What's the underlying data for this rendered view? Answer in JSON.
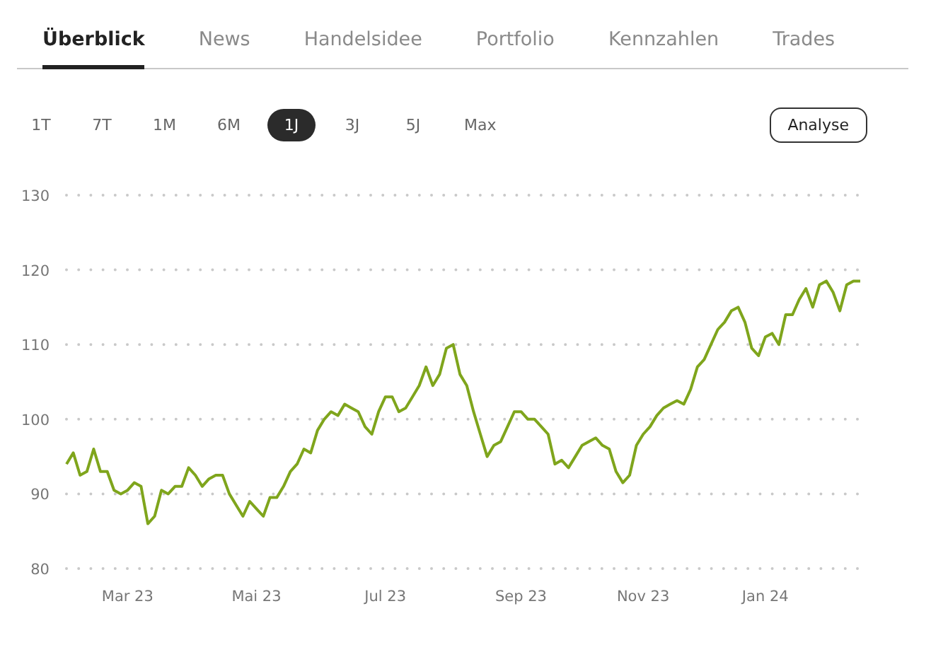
{
  "tabs": [
    {
      "label": "Überblick",
      "selected": true
    },
    {
      "label": "News",
      "selected": false
    },
    {
      "label": "Handelsidee",
      "selected": false
    },
    {
      "label": "Portfolio",
      "selected": false
    },
    {
      "label": "Kennzahlen",
      "selected": false
    },
    {
      "label": "Trades",
      "selected": false
    }
  ],
  "ranges": [
    {
      "label": "1T",
      "selected": false
    },
    {
      "label": "7T",
      "selected": false
    },
    {
      "label": "1M",
      "selected": false
    },
    {
      "label": "6M",
      "selected": false
    },
    {
      "label": "1J",
      "selected": true
    },
    {
      "label": "3J",
      "selected": false
    },
    {
      "label": "5J",
      "selected": false
    },
    {
      "label": "Max",
      "selected": false
    }
  ],
  "analyse_button": "Analyse",
  "chart": {
    "chart_data": {
      "type": "line",
      "grid": true,
      "ylim": [
        80,
        130
      ],
      "yticks": [
        80,
        90,
        100,
        110,
        120,
        130
      ],
      "categories": [
        null,
        null,
        null,
        null,
        null,
        null,
        null,
        null,
        null,
        "Mar 23",
        null,
        null,
        null,
        null,
        null,
        null,
        null,
        null,
        null,
        null,
        null,
        null,
        null,
        null,
        null,
        null,
        null,
        null,
        "Mai 23",
        null,
        null,
        null,
        null,
        null,
        null,
        null,
        null,
        null,
        null,
        null,
        null,
        null,
        null,
        null,
        null,
        null,
        null,
        "Jul 23",
        null,
        null,
        null,
        null,
        null,
        null,
        null,
        null,
        null,
        null,
        null,
        null,
        null,
        null,
        null,
        null,
        null,
        null,
        null,
        "Sep 23",
        null,
        null,
        null,
        null,
        null,
        null,
        null,
        null,
        null,
        null,
        null,
        null,
        null,
        null,
        null,
        null,
        null,
        "Nov 23",
        null,
        null,
        null,
        null,
        null,
        null,
        null,
        null,
        null,
        null,
        null,
        null,
        null,
        null,
        null,
        null,
        null,
        "Jan 24",
        null,
        null,
        null,
        null,
        null,
        null,
        null,
        null,
        null,
        null,
        null,
        null,
        null,
        null
      ],
      "series": [
        {
          "color": "#7fa51c",
          "values": [
            94,
            95.5,
            92.5,
            93,
            96,
            93,
            93,
            90.5,
            90,
            90.5,
            91.5,
            91,
            86,
            87,
            90.5,
            90,
            91,
            91,
            93.5,
            92.5,
            91,
            92,
            92.5,
            92.5,
            90,
            88.5,
            87,
            89,
            88,
            87,
            89.5,
            89.5,
            91,
            93,
            94,
            96,
            95.5,
            98.5,
            100,
            101,
            100.5,
            102,
            101.5,
            101,
            99,
            98,
            101,
            103,
            103,
            101,
            101.5,
            103,
            104.5,
            107,
            104.5,
            106,
            109.5,
            110,
            106,
            104.5,
            101,
            98,
            95,
            96.5,
            97,
            99,
            101,
            101,
            100,
            100,
            99,
            98,
            94,
            94.5,
            93.5,
            95,
            96.5,
            97,
            97.5,
            96.5,
            96,
            93,
            91.5,
            92.5,
            96.5,
            98,
            99,
            100.5,
            101.5,
            102,
            102.5,
            102,
            104,
            107,
            108,
            110,
            112,
            113,
            114.5,
            115,
            113,
            109.5,
            108.5,
            111,
            111.5,
            110,
            114,
            114,
            116,
            117.5,
            115,
            118,
            118.5,
            117,
            114.5,
            118,
            118.5,
            118.5
          ]
        }
      ]
    }
  }
}
